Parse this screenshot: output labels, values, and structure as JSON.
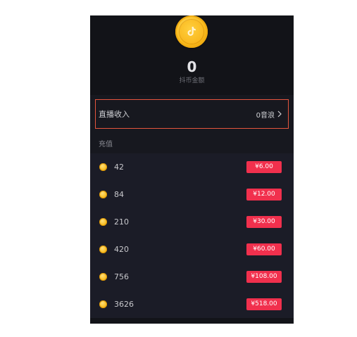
{
  "balance": {
    "amount": "0",
    "label": "抖币金额",
    "icon": "tiktok-coin-icon"
  },
  "income": {
    "label": "直播收入",
    "value": "0音浪",
    "icon": "chevron-right-icon"
  },
  "recharge": {
    "label": "充值",
    "coin_icon": "coin-icon",
    "options": [
      {
        "coins": "42",
        "price": "¥6.00"
      },
      {
        "coins": "84",
        "price": "¥12.00"
      },
      {
        "coins": "210",
        "price": "¥30.00"
      },
      {
        "coins": "420",
        "price": "¥60.00"
      },
      {
        "coins": "756",
        "price": "¥108.00"
      },
      {
        "coins": "3626",
        "price": "¥518.00"
      }
    ]
  },
  "colors": {
    "background": "#131419",
    "list_background": "#1b1c27",
    "price_button": "#f1304d",
    "highlight_border": "#e5553d",
    "coin_gold": "#f8bd22"
  }
}
